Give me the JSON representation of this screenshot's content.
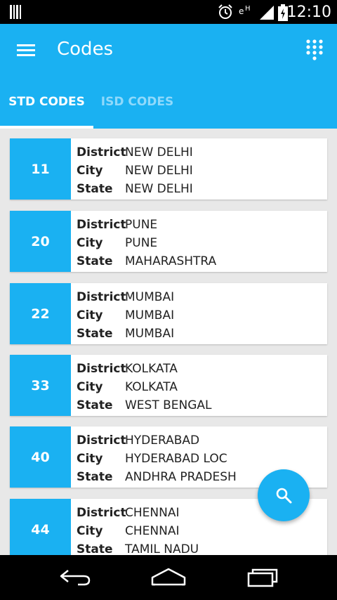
{
  "status_bar": {
    "time": "12:10"
  },
  "app_bar": {
    "title": "Codes",
    "menu_icon": "hamburger-menu-icon",
    "dialpad_icon": "dialpad-icon"
  },
  "tabs": [
    {
      "label": "STD CODES",
      "selected": true
    },
    {
      "label": "ISD CODES",
      "selected": false
    }
  ],
  "labels": {
    "district": "District",
    "city": "City",
    "state": "State"
  },
  "cards": [
    {
      "code": "11",
      "district": "NEW DELHI",
      "city": "NEW DELHI",
      "state": "NEW DELHI"
    },
    {
      "code": "20",
      "district": "PUNE",
      "city": "PUNE",
      "state": "MAHARASHTRA"
    },
    {
      "code": "22",
      "district": "MUMBAI",
      "city": "MUMBAI",
      "state": "MUMBAI"
    },
    {
      "code": "33",
      "district": "KOLKATA",
      "city": "KOLKATA",
      "state": "WEST BENGAL"
    },
    {
      "code": "40",
      "district": "HYDERABAD",
      "city": "HYDERABAD LOC",
      "state": "ANDHRA PRADESH"
    },
    {
      "code": "44",
      "district": "CHENNAI",
      "city": "CHENNAI",
      "state": "TAMIL NADU"
    }
  ],
  "fab": {
    "icon": "search-icon"
  },
  "colors": {
    "accent": "#1ab1f2",
    "background": "#e8e8e8"
  }
}
